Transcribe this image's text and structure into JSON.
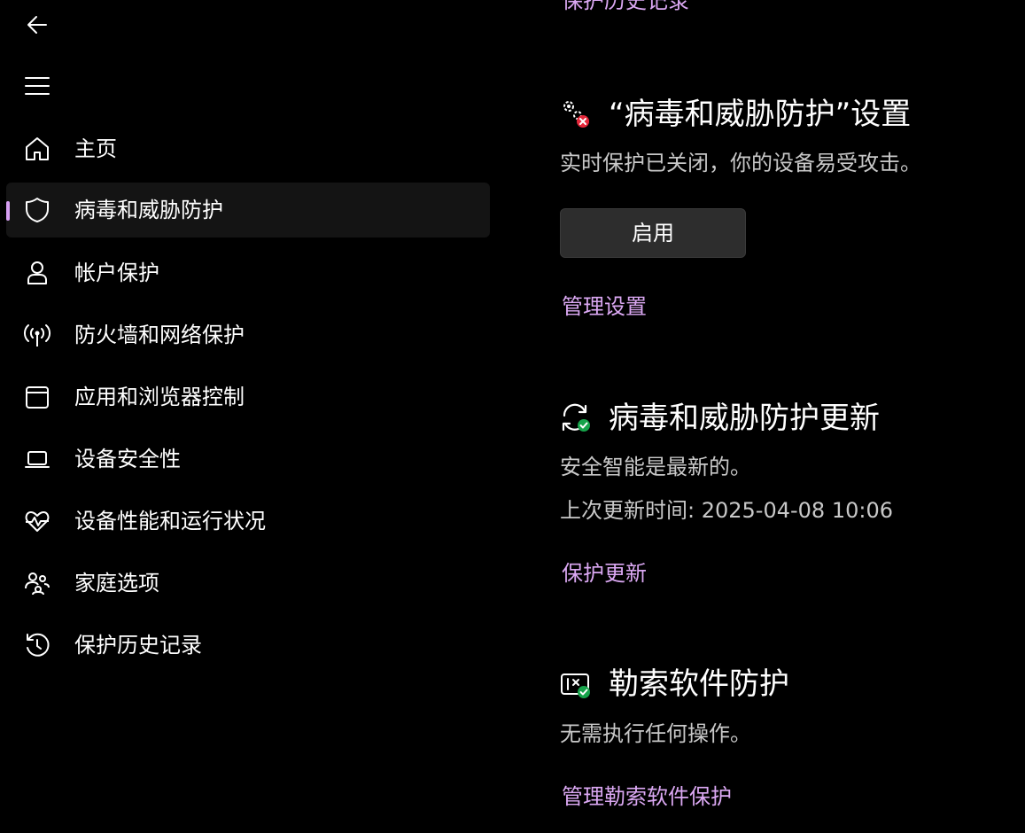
{
  "sidebar": {
    "items": [
      {
        "label": "主页",
        "icon": "home-icon"
      },
      {
        "label": "病毒和威胁防护",
        "icon": "shield-icon",
        "selected": true
      },
      {
        "label": "帐户保护",
        "icon": "person-icon"
      },
      {
        "label": "防火墙和网络保护",
        "icon": "wireless-antenna-icon"
      },
      {
        "label": "应用和浏览器控制",
        "icon": "browser-window-icon"
      },
      {
        "label": "设备安全性",
        "icon": "laptop-icon"
      },
      {
        "label": "设备性能和运行状况",
        "icon": "heart-pulse-icon"
      },
      {
        "label": "家庭选项",
        "icon": "family-icon"
      },
      {
        "label": "保护历史记录",
        "icon": "history-icon"
      }
    ]
  },
  "main": {
    "top_link": "保护历史记录",
    "settings": {
      "title": "“病毒和威胁防护”设置",
      "status": "实时保护已关闭，你的设备易受攻击。",
      "button": "启用",
      "link": "管理设置"
    },
    "updates": {
      "title": "病毒和威胁防护更新",
      "status": "安全智能是最新的。",
      "last_update": "上次更新时间: 2025-04-08 10:06",
      "link": "保护更新"
    },
    "ransomware": {
      "title": "勒索软件防护",
      "status": "无需执行任何操作。",
      "link": "管理勒索软件保护"
    }
  },
  "colors": {
    "accent": "#d69ff2",
    "link": "#dba8f3",
    "error": "#e5273a",
    "ok": "#16a34a"
  }
}
